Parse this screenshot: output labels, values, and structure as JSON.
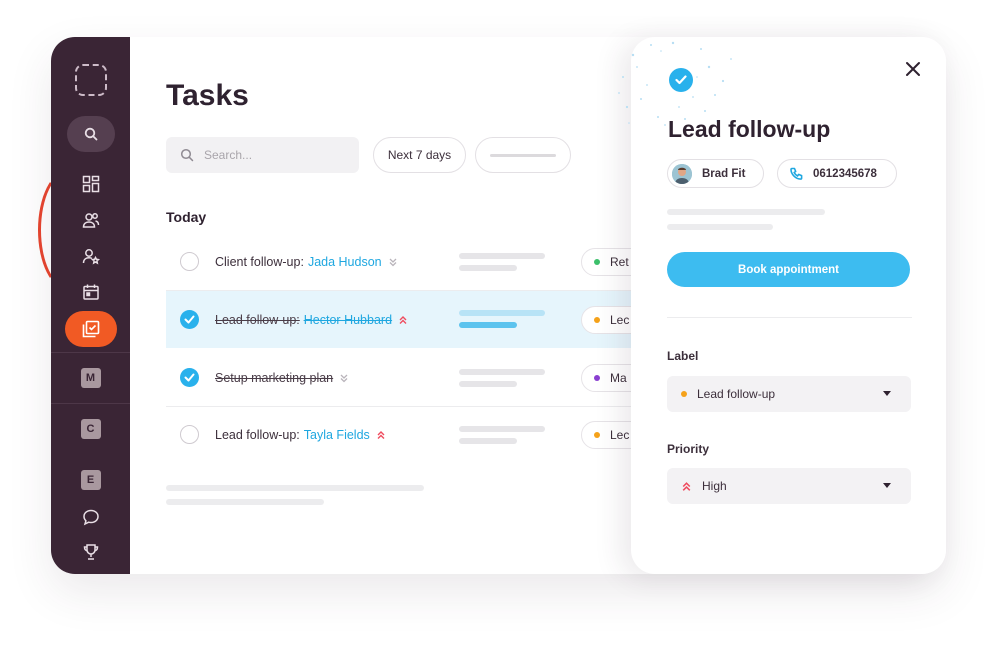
{
  "colors": {
    "sidebar": "#3a2535",
    "accent_orange": "#f15a24",
    "accent_blue": "#29b1ec",
    "link_blue": "#1fa7e0",
    "priority_red": "#ef4b5e",
    "dot_green": "#3cc06b",
    "dot_orange": "#f5a21a",
    "dot_purple": "#8a3fd1"
  },
  "sidebar": {
    "icons": [
      "logo-placeholder-icon",
      "search-icon",
      "dashboard-icon",
      "contacts-icon",
      "add-user-icon",
      "calendar-icon",
      "tasks-icon"
    ],
    "workspace_badges": [
      "M",
      "C",
      "E"
    ],
    "bottom_icons": [
      "chat-icon",
      "trophy-icon"
    ]
  },
  "main": {
    "title": "Tasks",
    "search": {
      "placeholder": "Search..."
    },
    "filter_label": "Next 7 days",
    "section_title": "Today",
    "tasks": [
      {
        "prefix": "Client follow-up:",
        "contact": "Jada Hudson",
        "done": false,
        "priority": "low",
        "label": "Ret",
        "label_color": "#3cc06b"
      },
      {
        "prefix": "Lead follow-up:",
        "contact": "Hector Hubbard",
        "done": true,
        "priority": "high",
        "label": "Lec",
        "label_color": "#f5a21a"
      },
      {
        "prefix": "Setup marketing plan",
        "contact": "",
        "done": true,
        "priority": "low",
        "label": "Ma",
        "label_color": "#8a3fd1"
      },
      {
        "prefix": "Lead follow-up:",
        "contact": "Tayla Fields",
        "done": false,
        "priority": "high",
        "label": "Lec",
        "label_color": "#f5a21a"
      }
    ]
  },
  "panel": {
    "title": "Lead follow-up",
    "contact_name": "Brad Fit",
    "phone": "0612345678",
    "book_button": "Book appointment",
    "label_field": {
      "label": "Label",
      "value": "Lead follow-up"
    },
    "priority_field": {
      "label": "Priority",
      "value": "High"
    }
  }
}
